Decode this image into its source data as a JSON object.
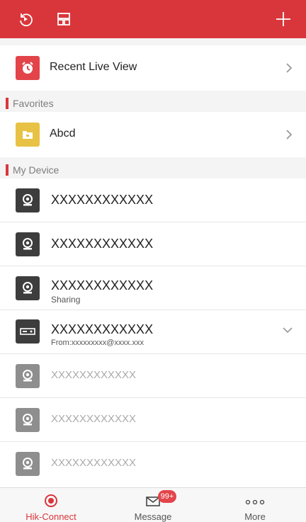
{
  "header": {
    "icons": [
      "refresh-icon",
      "layout-icon",
      "add-icon"
    ],
    "accent": "#d9363b"
  },
  "recent": {
    "label": "Recent Live View"
  },
  "favorites": {
    "section_label": "Favorites",
    "item_label": "Abcd"
  },
  "mydevice": {
    "section_label": "My Device",
    "devices": [
      {
        "name": "XXXXXXXXXXXX",
        "sub": ""
      },
      {
        "name": "XXXXXXXXXXXX",
        "sub": ""
      },
      {
        "name": "XXXXXXXXXXXX",
        "sub": "Sharing"
      },
      {
        "name": "XXXXXXXXXXXX",
        "sub": "From:xxxxxxxxx@xxxx.xxx"
      },
      {
        "name": "XXXXXXXXXXXX",
        "sub": ""
      },
      {
        "name": "XXXXXXXXXXXX",
        "sub": ""
      },
      {
        "name": "XXXXXXXXXXXX",
        "sub": ""
      }
    ]
  },
  "tabs": [
    {
      "label": "Hik-Connect",
      "active": true
    },
    {
      "label": "Message",
      "badge": "99+"
    },
    {
      "label": "More"
    }
  ]
}
